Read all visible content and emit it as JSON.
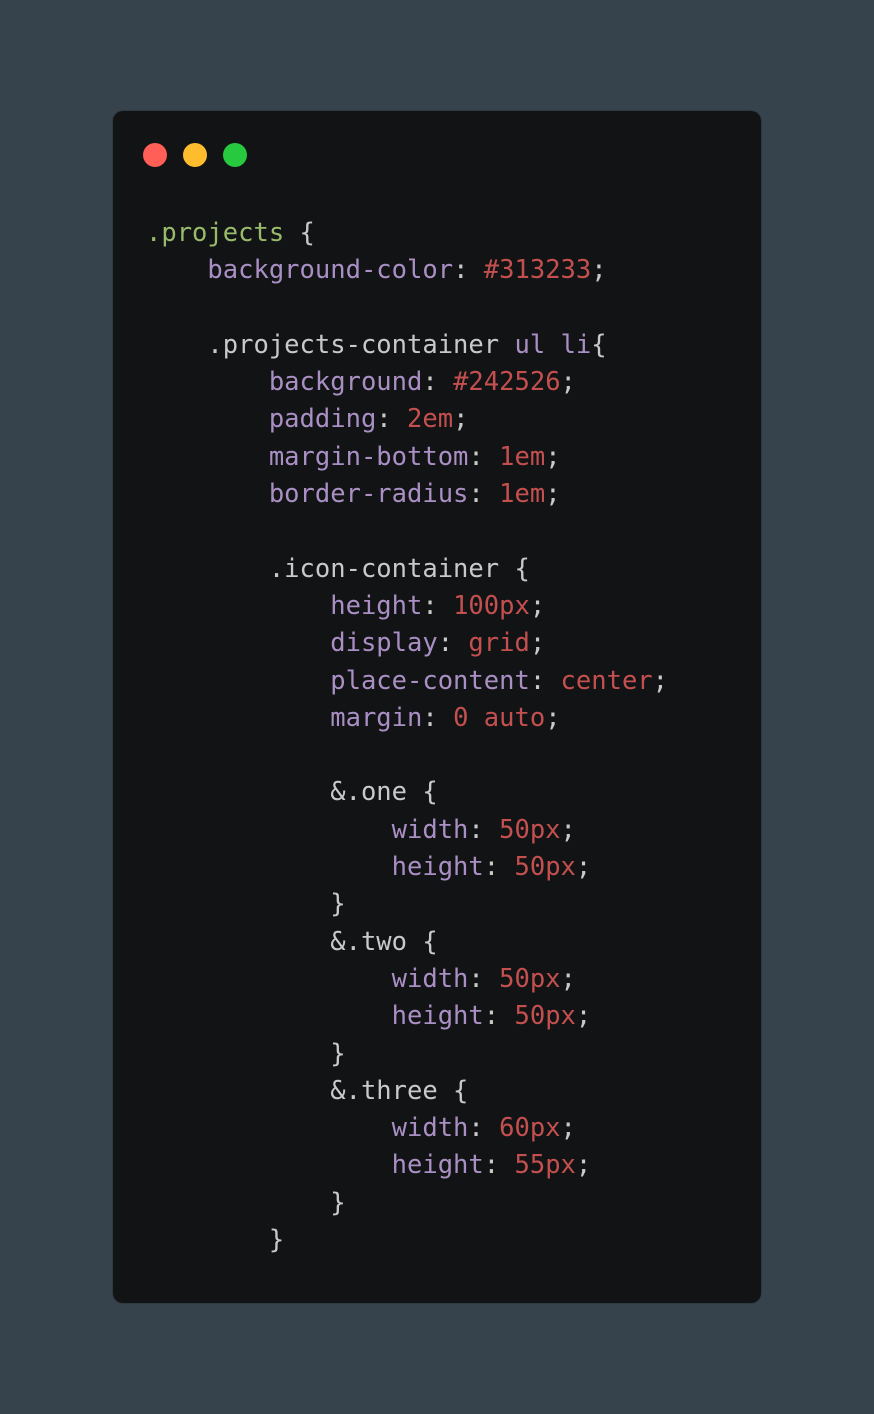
{
  "window": {
    "traffic_lights": [
      {
        "name": "close",
        "color": "#ff5f56"
      },
      {
        "name": "minimize",
        "color": "#ffbd2e"
      },
      {
        "name": "maximize",
        "color": "#27c93f"
      }
    ]
  },
  "colors": {
    "background": "#37434c",
    "editor": "#121315",
    "selector_main": "#9aba6b",
    "selector": "#c9c9c9",
    "property": "#a98fc4",
    "value": "#c3504f"
  },
  "code_lines": [
    {
      "indent": 0,
      "tokens": [
        {
          "t": ".projects",
          "c": "selector-main"
        },
        {
          "t": " {",
          "c": "punct"
        }
      ]
    },
    {
      "indent": 1,
      "tokens": [
        {
          "t": "background-color",
          "c": "prop"
        },
        {
          "t": ": ",
          "c": "punct"
        },
        {
          "t": "#313233",
          "c": "value"
        },
        {
          "t": ";",
          "c": "punct"
        }
      ]
    },
    {
      "indent": 0,
      "tokens": []
    },
    {
      "indent": 1,
      "tokens": [
        {
          "t": ".projects-container",
          "c": "selector"
        },
        {
          "t": " ",
          "c": "punct"
        },
        {
          "t": "ul",
          "c": "tag"
        },
        {
          "t": " ",
          "c": "punct"
        },
        {
          "t": "li",
          "c": "tag"
        },
        {
          "t": "{",
          "c": "punct"
        }
      ]
    },
    {
      "indent": 2,
      "tokens": [
        {
          "t": "background",
          "c": "prop"
        },
        {
          "t": ": ",
          "c": "punct"
        },
        {
          "t": "#242526",
          "c": "value"
        },
        {
          "t": ";",
          "c": "punct"
        }
      ]
    },
    {
      "indent": 2,
      "tokens": [
        {
          "t": "padding",
          "c": "prop"
        },
        {
          "t": ": ",
          "c": "punct"
        },
        {
          "t": "2em",
          "c": "value"
        },
        {
          "t": ";",
          "c": "punct"
        }
      ]
    },
    {
      "indent": 2,
      "tokens": [
        {
          "t": "margin-bottom",
          "c": "prop"
        },
        {
          "t": ": ",
          "c": "punct"
        },
        {
          "t": "1em",
          "c": "value"
        },
        {
          "t": ";",
          "c": "punct"
        }
      ]
    },
    {
      "indent": 2,
      "tokens": [
        {
          "t": "border-radius",
          "c": "prop"
        },
        {
          "t": ": ",
          "c": "punct"
        },
        {
          "t": "1em",
          "c": "value"
        },
        {
          "t": ";",
          "c": "punct"
        }
      ]
    },
    {
      "indent": 0,
      "tokens": []
    },
    {
      "indent": 2,
      "tokens": [
        {
          "t": ".icon-container",
          "c": "selector"
        },
        {
          "t": " {",
          "c": "punct"
        }
      ]
    },
    {
      "indent": 3,
      "tokens": [
        {
          "t": "height",
          "c": "prop"
        },
        {
          "t": ": ",
          "c": "punct"
        },
        {
          "t": "100px",
          "c": "value"
        },
        {
          "t": ";",
          "c": "punct"
        }
      ]
    },
    {
      "indent": 3,
      "tokens": [
        {
          "t": "display",
          "c": "prop"
        },
        {
          "t": ": ",
          "c": "punct"
        },
        {
          "t": "grid",
          "c": "value"
        },
        {
          "t": ";",
          "c": "punct"
        }
      ]
    },
    {
      "indent": 3,
      "tokens": [
        {
          "t": "place-content",
          "c": "prop"
        },
        {
          "t": ": ",
          "c": "punct"
        },
        {
          "t": "center",
          "c": "value"
        },
        {
          "t": ";",
          "c": "punct"
        }
      ]
    },
    {
      "indent": 3,
      "tokens": [
        {
          "t": "margin",
          "c": "prop"
        },
        {
          "t": ": ",
          "c": "punct"
        },
        {
          "t": "0 auto",
          "c": "value"
        },
        {
          "t": ";",
          "c": "punct"
        }
      ]
    },
    {
      "indent": 0,
      "tokens": []
    },
    {
      "indent": 3,
      "tokens": [
        {
          "t": "&.one",
          "c": "selector"
        },
        {
          "t": " {",
          "c": "punct"
        }
      ]
    },
    {
      "indent": 4,
      "tokens": [
        {
          "t": "width",
          "c": "prop"
        },
        {
          "t": ": ",
          "c": "punct"
        },
        {
          "t": "50px",
          "c": "value"
        },
        {
          "t": ";",
          "c": "punct"
        }
      ]
    },
    {
      "indent": 4,
      "tokens": [
        {
          "t": "height",
          "c": "prop"
        },
        {
          "t": ": ",
          "c": "punct"
        },
        {
          "t": "50px",
          "c": "value"
        },
        {
          "t": ";",
          "c": "punct"
        }
      ]
    },
    {
      "indent": 3,
      "tokens": [
        {
          "t": "}",
          "c": "punct"
        }
      ]
    },
    {
      "indent": 3,
      "tokens": [
        {
          "t": "&.two",
          "c": "selector"
        },
        {
          "t": " {",
          "c": "punct"
        }
      ]
    },
    {
      "indent": 4,
      "tokens": [
        {
          "t": "width",
          "c": "prop"
        },
        {
          "t": ": ",
          "c": "punct"
        },
        {
          "t": "50px",
          "c": "value"
        },
        {
          "t": ";",
          "c": "punct"
        }
      ]
    },
    {
      "indent": 4,
      "tokens": [
        {
          "t": "height",
          "c": "prop"
        },
        {
          "t": ": ",
          "c": "punct"
        },
        {
          "t": "50px",
          "c": "value"
        },
        {
          "t": ";",
          "c": "punct"
        }
      ]
    },
    {
      "indent": 3,
      "tokens": [
        {
          "t": "}",
          "c": "punct"
        }
      ]
    },
    {
      "indent": 3,
      "tokens": [
        {
          "t": "&.three",
          "c": "selector"
        },
        {
          "t": " {",
          "c": "punct"
        }
      ]
    },
    {
      "indent": 4,
      "tokens": [
        {
          "t": "width",
          "c": "prop"
        },
        {
          "t": ": ",
          "c": "punct"
        },
        {
          "t": "60px",
          "c": "value"
        },
        {
          "t": ";",
          "c": "punct"
        }
      ]
    },
    {
      "indent": 4,
      "tokens": [
        {
          "t": "height",
          "c": "prop"
        },
        {
          "t": ": ",
          "c": "punct"
        },
        {
          "t": "55px",
          "c": "value"
        },
        {
          "t": ";",
          "c": "punct"
        }
      ]
    },
    {
      "indent": 3,
      "tokens": [
        {
          "t": "}",
          "c": "punct"
        }
      ]
    },
    {
      "indent": 2,
      "tokens": [
        {
          "t": "}",
          "c": "punct"
        }
      ]
    }
  ]
}
